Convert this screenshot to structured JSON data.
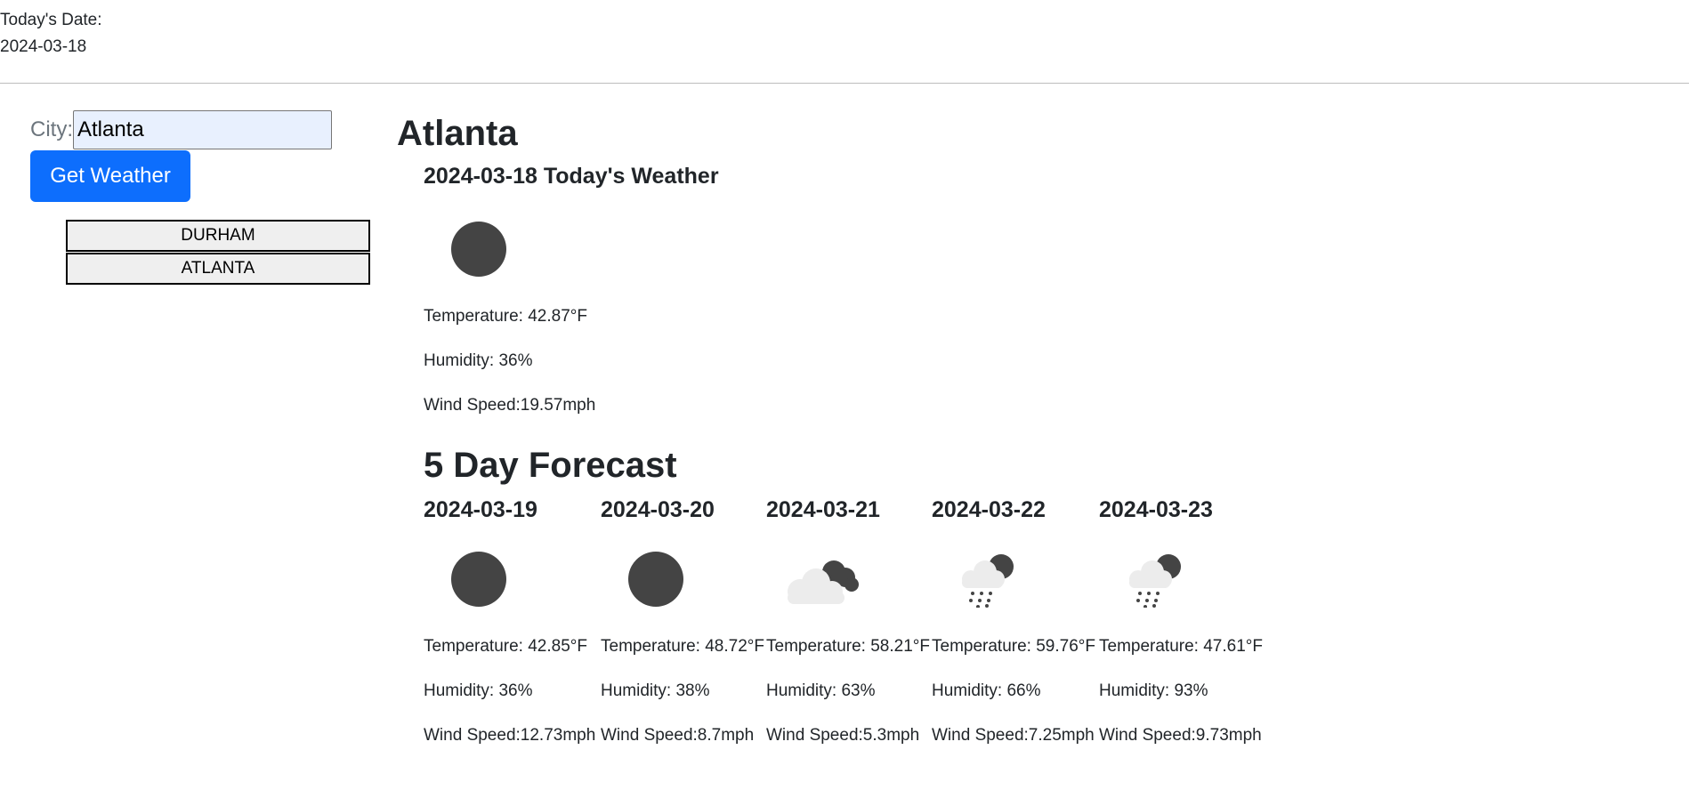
{
  "header": {
    "date_label": "Today's Date:",
    "date_value": "2024-03-18"
  },
  "search": {
    "label": "City:",
    "value": "Atlanta",
    "button_label": "Get Weather"
  },
  "history": [
    "DURHAM",
    "ATLANTA"
  ],
  "current": {
    "city": "Atlanta",
    "heading": "2024-03-18 Today's Weather",
    "icon": "clear-sky-icon",
    "temperature": "Temperature: 42.87°F",
    "humidity": "Humidity: 36%",
    "wind": "Wind Speed:19.57mph"
  },
  "forecast": {
    "title": "5 Day Forecast",
    "days": [
      {
        "date": "2024-03-19",
        "icon": "clear-sky-icon",
        "temperature": "Temperature: 42.85°F",
        "humidity": "Humidity: 36%",
        "wind": "Wind Speed:12.73mph"
      },
      {
        "date": "2024-03-20",
        "icon": "clear-sky-icon",
        "temperature": "Temperature: 48.72°F",
        "humidity": "Humidity: 38%",
        "wind": "Wind Speed:8.7mph"
      },
      {
        "date": "2024-03-21",
        "icon": "broken-clouds-icon",
        "temperature": "Temperature: 58.21°F",
        "humidity": "Humidity: 63%",
        "wind": "Wind Speed:5.3mph"
      },
      {
        "date": "2024-03-22",
        "icon": "rain-icon",
        "temperature": "Temperature: 59.76°F",
        "humidity": "Humidity: 66%",
        "wind": "Wind Speed:7.25mph"
      },
      {
        "date": "2024-03-23",
        "icon": "rain-icon",
        "temperature": "Temperature: 47.61°F",
        "humidity": "Humidity: 93%",
        "wind": "Wind Speed:9.73mph"
      }
    ]
  }
}
